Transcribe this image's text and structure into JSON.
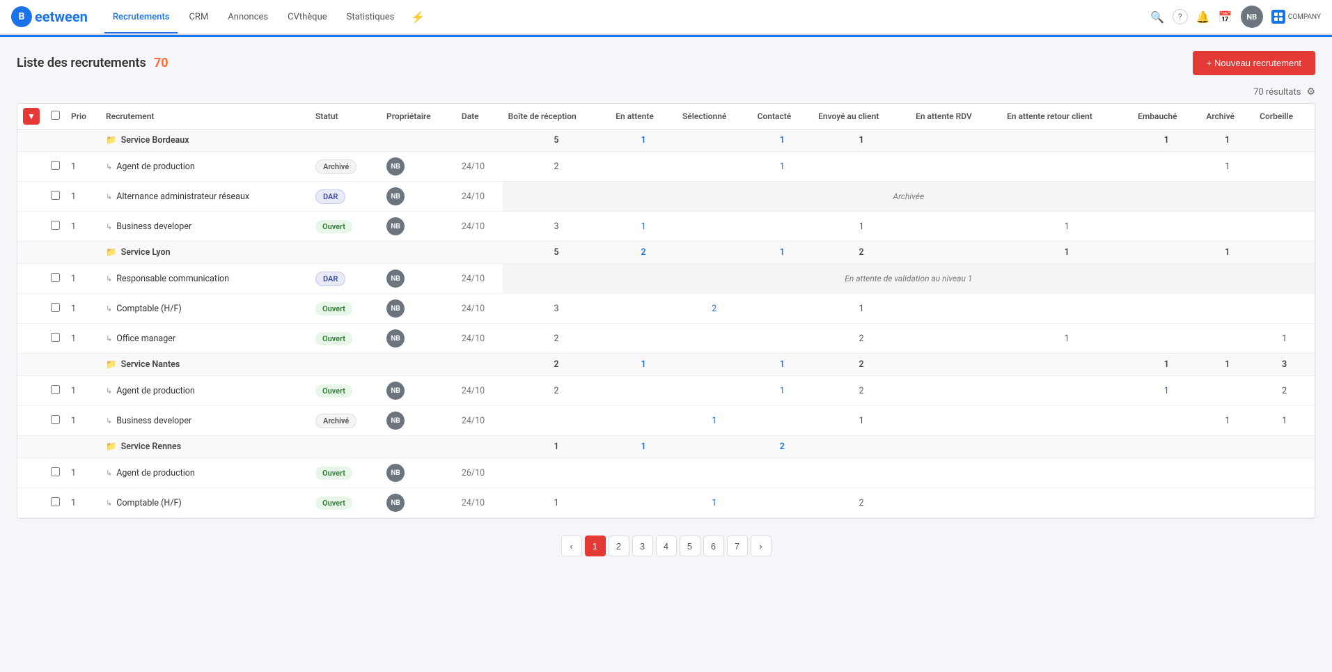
{
  "app": {
    "logo_letter": "B",
    "logo_text": "eetween"
  },
  "nav": {
    "items": [
      {
        "id": "recrutements",
        "label": "Recrutements",
        "active": true
      },
      {
        "id": "crm",
        "label": "CRM",
        "active": false
      },
      {
        "id": "annonces",
        "label": "Annonces",
        "active": false
      },
      {
        "id": "cvtheque",
        "label": "CVthèque",
        "active": false
      },
      {
        "id": "statistiques",
        "label": "Statistiques",
        "active": false
      }
    ]
  },
  "header": {
    "title": "Liste des recrutements",
    "count": "70",
    "new_button": "+ Nouveau recrutement",
    "results_label": "70 résultats"
  },
  "columns": {
    "prio": "Prio",
    "recrutement": "Recrutement",
    "statut": "Statut",
    "proprietaire": "Propriétaire",
    "date": "Date",
    "boite_reception": "Boîte de réception",
    "en_attente": "En attente",
    "selectionne": "Sélectionné",
    "contacte": "Contacté",
    "envoye_client": "Envoyé au client",
    "en_attente_rdv": "En attente RDV",
    "en_attente_retour": "En attente retour client",
    "embauche": "Embauché",
    "archive": "Archivé",
    "corbeille": "Corbeille"
  },
  "groups": [
    {
      "id": "bordeaux",
      "name": "Service Bordeaux",
      "totals": {
        "boite": "5",
        "en_attente": "1",
        "contacte": "1",
        "envoye": "1",
        "embauche": "1",
        "archive": "1"
      },
      "rows": [
        {
          "prio": "1",
          "name": "Agent de production",
          "statut": "Archivé",
          "statut_type": "archive",
          "owner": "NB",
          "date": "24/10",
          "boite": "2",
          "en_attente": "",
          "selectionne": "",
          "contacte": "1",
          "envoye": "",
          "rdv": "",
          "retour": "",
          "embauche": "",
          "archive": "1",
          "corbeille": "",
          "overlay": null
        },
        {
          "prio": "1",
          "name": "Alternance administrateur réseaux",
          "statut": "DAR",
          "statut_type": "dar",
          "owner": "NB",
          "date": "24/10",
          "boite": "",
          "en_attente": "",
          "selectionne": "",
          "contacte": "",
          "envoye": "",
          "rdv": "",
          "retour": "",
          "embauche": "",
          "archive": "",
          "corbeille": "",
          "overlay": "Archivée"
        },
        {
          "prio": "1",
          "name": "Business developer",
          "statut": "Ouvert",
          "statut_type": "ouvert",
          "owner": "NB",
          "date": "24/10",
          "boite": "3",
          "en_attente": "1",
          "selectionne": "",
          "contacte": "",
          "envoye": "1",
          "rdv": "",
          "retour": "1",
          "embauche": "",
          "archive": "",
          "corbeille": "",
          "overlay": null
        }
      ]
    },
    {
      "id": "lyon",
      "name": "Service Lyon",
      "totals": {
        "boite": "5",
        "en_attente": "2",
        "selectionne": "",
        "contacte": "1",
        "envoye": "2",
        "rdv": "",
        "retour": "1",
        "embauche": "",
        "archive": "1"
      },
      "rows": [
        {
          "prio": "1",
          "name": "Responsable communication",
          "statut": "DAR",
          "statut_type": "dar",
          "owner": "NB",
          "date": "24/10",
          "boite": "",
          "en_attente": "",
          "selectionne": "",
          "contacte": "",
          "envoye": "",
          "rdv": "",
          "retour": "",
          "embauche": "",
          "archive": "",
          "corbeille": "",
          "overlay": "En attente de validation au niveau 1"
        },
        {
          "prio": "1",
          "name": "Comptable (H/F)",
          "statut": "Ouvert",
          "statut_type": "ouvert",
          "owner": "NB",
          "date": "24/10",
          "boite": "3",
          "en_attente": "",
          "selectionne": "2",
          "contacte": "",
          "envoye": "1",
          "rdv": "",
          "retour": "",
          "embauche": "",
          "archive": "",
          "corbeille": "",
          "overlay": null
        },
        {
          "prio": "1",
          "name": "Office manager",
          "statut": "Ouvert",
          "statut_type": "ouvert",
          "owner": "NB",
          "date": "24/10",
          "boite": "2",
          "en_attente": "",
          "selectionne": "",
          "contacte": "",
          "envoye": "2",
          "rdv": "",
          "retour": "1",
          "embauche": "",
          "archive": "",
          "corbeille": "1",
          "overlay": null
        }
      ]
    },
    {
      "id": "nantes",
      "name": "Service Nantes",
      "totals": {
        "boite": "2",
        "en_attente": "1",
        "selectionne": "",
        "contacte": "1",
        "envoye": "2",
        "rdv": "",
        "retour": "",
        "embauche": "1",
        "archive": "1",
        "corbeille": "3"
      },
      "rows": [
        {
          "prio": "1",
          "name": "Agent de production",
          "statut": "Ouvert",
          "statut_type": "ouvert",
          "owner": "NB",
          "date": "24/10",
          "boite": "2",
          "en_attente": "",
          "selectionne": "",
          "contacte": "1",
          "envoye": "2",
          "rdv": "",
          "retour": "",
          "embauche": "1",
          "archive": "",
          "corbeille": "2",
          "overlay": null
        },
        {
          "prio": "1",
          "name": "Business developer",
          "statut": "Archivé",
          "statut_type": "archive",
          "owner": "NB",
          "date": "24/10",
          "boite": "",
          "en_attente": "",
          "selectionne": "1",
          "contacte": "",
          "envoye": "1",
          "rdv": "",
          "retour": "",
          "embauche": "",
          "archive": "1",
          "corbeille": "1",
          "overlay": null
        }
      ]
    },
    {
      "id": "rennes",
      "name": "Service Rennes",
      "totals": {
        "boite": "1",
        "en_attente": "1",
        "selectionne": "",
        "contacte": "2",
        "envoye": "",
        "rdv": "",
        "retour": "",
        "embauche": "",
        "archive": "",
        "corbeille": ""
      },
      "rows": [
        {
          "prio": "1",
          "name": "Agent de production",
          "statut": "Ouvert",
          "statut_type": "ouvert",
          "owner": "NB",
          "date": "26/10",
          "boite": "",
          "en_attente": "",
          "selectionne": "",
          "contacte": "",
          "envoye": "",
          "rdv": "",
          "retour": "",
          "embauche": "",
          "archive": "",
          "corbeille": "",
          "overlay": null
        },
        {
          "prio": "1",
          "name": "Comptable (H/F)",
          "statut": "Ouvert",
          "statut_type": "ouvert",
          "owner": "NB",
          "date": "24/10",
          "boite": "1",
          "en_attente": "",
          "selectionne": "1",
          "contacte": "",
          "envoye": "2",
          "rdv": "",
          "retour": "",
          "embauche": "",
          "archive": "",
          "corbeille": "",
          "overlay": null
        }
      ]
    }
  ],
  "pagination": {
    "prev": "‹",
    "next": "›",
    "pages": [
      "1",
      "2",
      "3",
      "4",
      "5",
      "6",
      "7"
    ],
    "active": "1"
  },
  "icons": {
    "search": "🔍",
    "help": "?",
    "bell": "🔔",
    "calendar": "📅",
    "bolt": "⚡",
    "folder": "📁",
    "filter": "▼",
    "settings": "⚙"
  }
}
